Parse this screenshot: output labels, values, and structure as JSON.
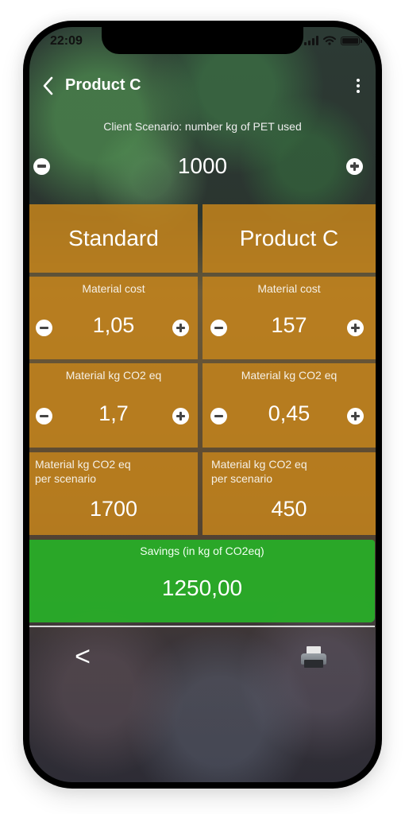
{
  "status_bar": {
    "time": "22:09",
    "icons": [
      "signal-icon",
      "wifi-icon",
      "battery-icon"
    ]
  },
  "nav": {
    "back_icon": "chevron-left-icon",
    "title": "Product C",
    "more_icon": "more-vertical-icon"
  },
  "scenario": {
    "label": "Client Scenario: number kg of PET used",
    "value": "1000",
    "minus_icon": "minus-circle-icon",
    "plus_icon": "plus-circle-icon"
  },
  "columns": [
    {
      "header": "Standard",
      "material_cost": {
        "label": "Material cost",
        "value": "1,05"
      },
      "material_co2": {
        "label": "Material kg CO2 eq",
        "value": "1,7"
      },
      "per_scenario": {
        "label_line1": "Material kg CO2 eq",
        "label_line2": "per scenario",
        "value": "1700"
      }
    },
    {
      "header": "Product C",
      "material_cost": {
        "label": "Material cost",
        "value": "157"
      },
      "material_co2": {
        "label": "Material kg CO2 eq",
        "value": "0,45"
      },
      "per_scenario": {
        "label_line1": "Material kg CO2 eq",
        "label_line2": "per scenario",
        "value": "450"
      }
    }
  ],
  "savings": {
    "label": "Savings (in kg of CO2eq)",
    "value": "1250,00"
  },
  "bottom_bar": {
    "back_label": "<",
    "print_icon": "printer-icon"
  },
  "colors": {
    "tile": "#c4841c",
    "savings": "#28af28",
    "text": "#ffffff"
  }
}
